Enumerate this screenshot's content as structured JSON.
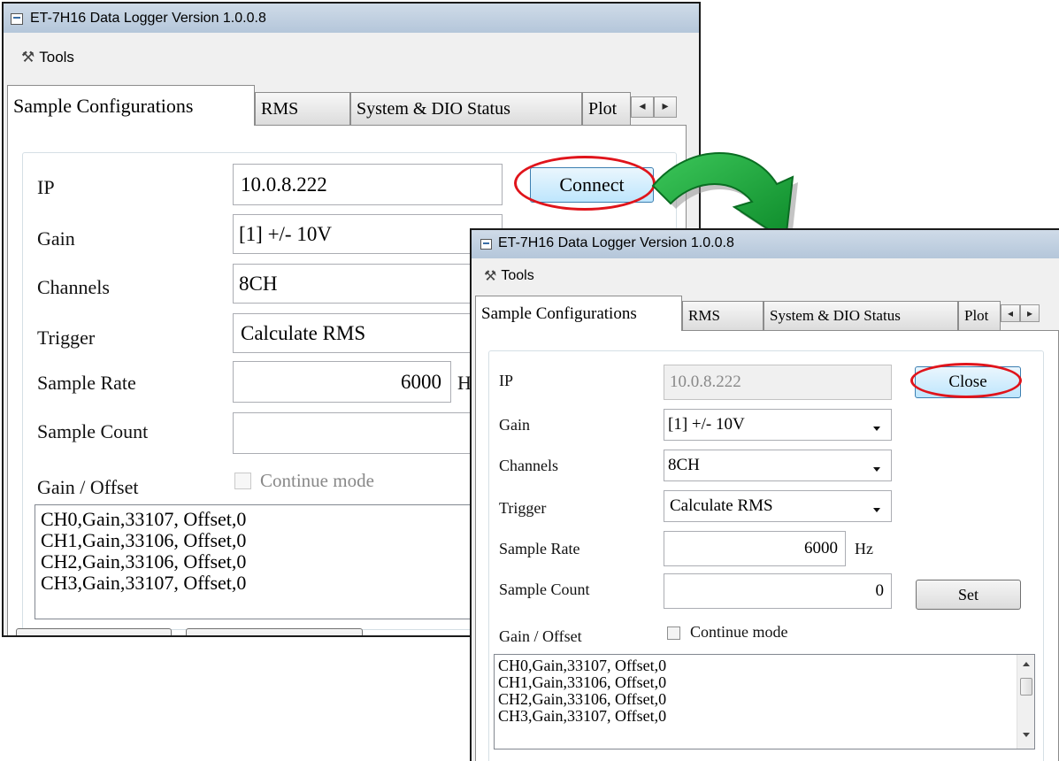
{
  "window_title": "ET-7H16 Data Logger Version 1.0.0.8",
  "menu": {
    "tools": "Tools"
  },
  "tabs": [
    "Sample Configurations",
    "RMS",
    "System & DIO Status",
    "Plot"
  ],
  "tab_scroll": {
    "left": "◂",
    "right": "▸"
  },
  "labels": {
    "ip": "IP",
    "gain": "Gain",
    "channels": "Channels",
    "trigger": "Trigger",
    "sample_rate": "Sample Rate",
    "sample_count": "Sample Count",
    "gain_offset": "Gain / Offset",
    "continue_mode": "Continue mode",
    "hz": "Hz"
  },
  "before": {
    "ip_value": "10.0.8.222",
    "gain_value": "[1] +/- 10V",
    "channels_value": "8CH",
    "trigger_value": "Calculate RMS",
    "sample_rate_value": "6000",
    "sample_count_value": "",
    "connect_label": "Connect",
    "hz_partial": "H:",
    "continue_mode_checked": false,
    "gain_offset_lines": [
      "CH0,Gain,33107, Offset,0",
      "CH1,Gain,33106, Offset,0",
      "CH2,Gain,33106, Offset,0",
      "CH3,Gain,33107, Offset,0"
    ]
  },
  "after": {
    "ip_value": "10.0.8.222",
    "ip_disabled": true,
    "gain_value": "[1] +/- 10V",
    "channels_value": "8CH",
    "trigger_value": "Calculate RMS",
    "sample_rate_value": "6000",
    "sample_count_value": "0",
    "close_label": "Close",
    "set_label": "Set",
    "continue_mode_checked": false,
    "gain_offset_lines": [
      "CH0,Gain,33107, Offset,0",
      "CH1,Gain,33106, Offset,0",
      "CH2,Gain,33106, Offset,0",
      "CH3,Gain,33107, Offset,0"
    ]
  },
  "colors": {
    "highlight_ellipse": "#e0141b",
    "arrow_green": "#1aa33a",
    "arrow_green_dark": "#0d7a26",
    "titlebar": "#c3d3e4"
  },
  "icons": [
    "app-window-icon",
    "tools-icon",
    "tab-scroll-left-icon",
    "tab-scroll-right-icon",
    "dropdown-arrow-icon",
    "checkbox-icon",
    "scroll-up-icon",
    "scroll-down-icon"
  ]
}
